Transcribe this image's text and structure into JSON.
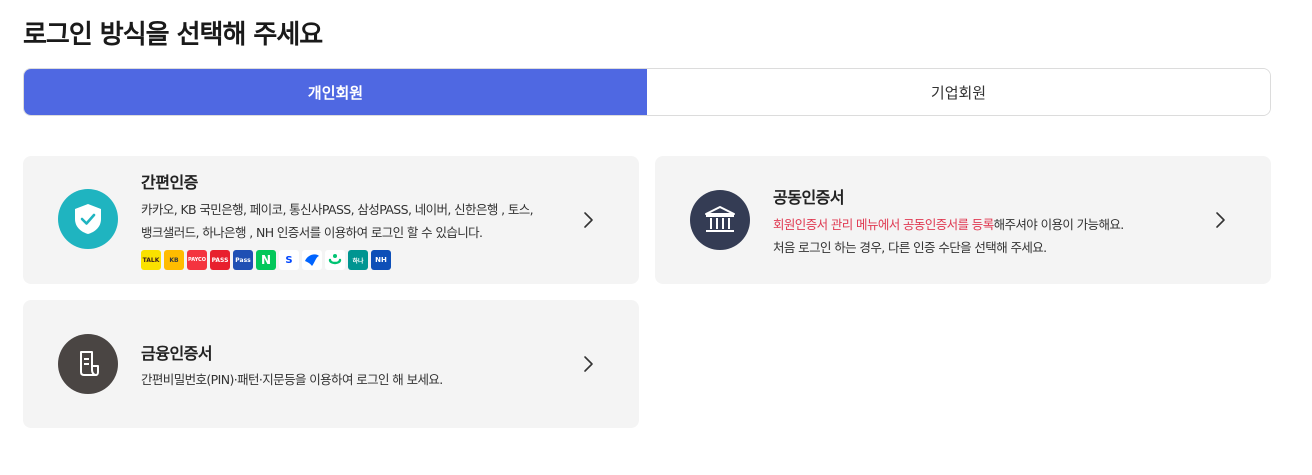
{
  "page": {
    "title": "로그인 방식을 선택해 주세요"
  },
  "tabs": [
    {
      "label": "개인회원",
      "active": true
    },
    {
      "label": "기업회원",
      "active": false
    }
  ],
  "cards": {
    "simple": {
      "title": "간편인증",
      "desc_line1": "카카오, KB 국민은행, 페이코, 통신사PASS, 삼성PASS, 네이버, 신한은행 , 토스,",
      "desc_line2": "뱅크샐러드, 하나은행 , NH 인증서를 이용하여 로그인 할 수 있습니다.",
      "icon": "shield-check-icon",
      "icon_color": "#1fb4c0"
    },
    "joint": {
      "title": "공동인증서",
      "desc_highlight": "회원인증서 관리 메뉴에서 공동인증서를 등록",
      "desc_rest": "해주셔야 이용이 가능해요.",
      "desc_line2": "처음 로그인 하는 경우, 다른 인증 수단을 선택해 주세요.",
      "icon": "bank-icon",
      "icon_color": "#343c54",
      "highlight_color": "#e03a52"
    },
    "financial": {
      "title": "금융인증서",
      "desc_line1": "간편비밀번호(PIN)·패턴·지문등을 이용하여 로그인 해 보세요.",
      "icon": "document-icon",
      "icon_color": "#4a4543"
    }
  },
  "provider_logos": [
    {
      "name": "kakao-logo",
      "label": "TALK",
      "bg": "#fae100",
      "fg": "#3a1d1d"
    },
    {
      "name": "kb-logo",
      "label": "KB",
      "bg": "#ffbc00",
      "fg": "#3a3a3a"
    },
    {
      "name": "payco-logo",
      "label": "PAYCO",
      "bg": "#f4343f",
      "fg": "#ffffff"
    },
    {
      "name": "pass-logo",
      "label": "PASS",
      "bg": "#e8202e",
      "fg": "#ffffff"
    },
    {
      "name": "samsung-pass-logo",
      "label": "Pass",
      "bg": "#1f4fb4",
      "fg": "#ffffff"
    },
    {
      "name": "naver-logo",
      "label": "N",
      "bg": "#03c75a",
      "fg": "#ffffff"
    },
    {
      "name": "shinhan-logo",
      "label": "S",
      "bg": "#ffffff",
      "fg": "#0046ff"
    },
    {
      "name": "toss-logo",
      "label": "",
      "bg": "#ffffff",
      "fg": "#0064ff"
    },
    {
      "name": "banksalad-logo",
      "label": "",
      "bg": "#ffffff",
      "fg": "#00c473"
    },
    {
      "name": "hana-logo",
      "label": "하나",
      "bg": "#009591",
      "fg": "#ffffff"
    },
    {
      "name": "nh-logo",
      "label": "NH",
      "bg": "#0d4fb8",
      "fg": "#ffffff"
    }
  ]
}
